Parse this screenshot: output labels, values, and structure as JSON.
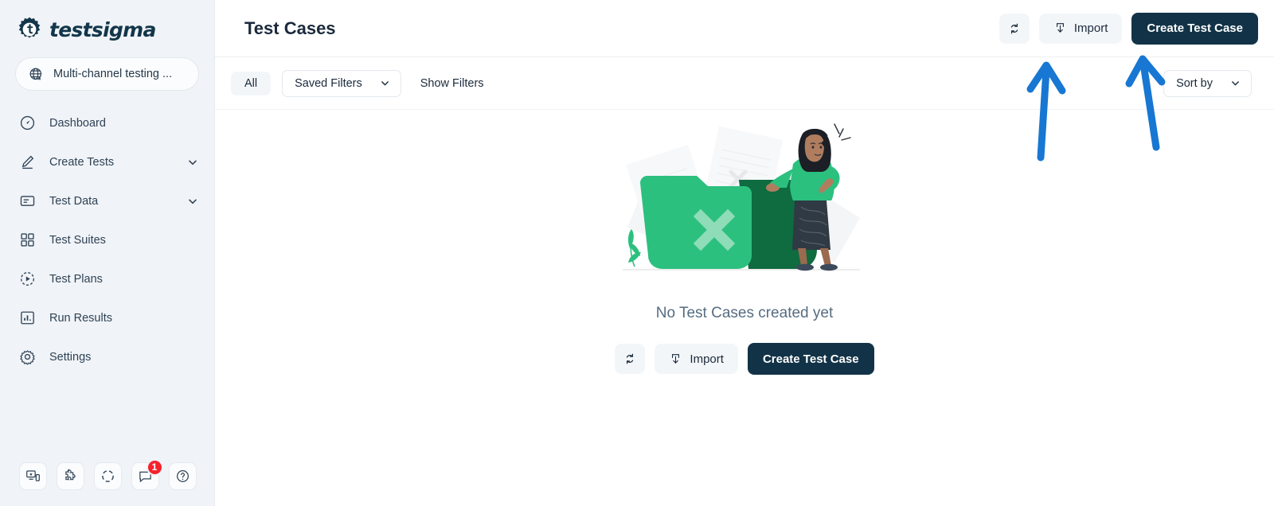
{
  "sidebar": {
    "brand": "testsigma",
    "brand_icon": "testsigma-gear-logo",
    "project": {
      "icon": "globe-icon",
      "name": "Multi-channel testing ..."
    },
    "nav": [
      {
        "label": "Dashboard",
        "icon": "speedometer-icon",
        "expandable": false
      },
      {
        "label": "Create Tests",
        "icon": "pencil-icon",
        "expandable": true
      },
      {
        "label": "Test Data",
        "icon": "data-folder-icon",
        "expandable": true
      },
      {
        "label": "Test Suites",
        "icon": "grid-squares-icon",
        "expandable": false
      },
      {
        "label": "Test Plans",
        "icon": "play-circle-icon",
        "expandable": false
      },
      {
        "label": "Run Results",
        "icon": "bar-chart-icon",
        "expandable": false
      },
      {
        "label": "Settings",
        "icon": "gear-icon",
        "expandable": false
      }
    ],
    "bottom_icons": [
      {
        "name": "devices-screen-icon",
        "badge": ""
      },
      {
        "name": "puzzle-piece-icon",
        "badge": ""
      },
      {
        "name": "dashed-circle-icon",
        "badge": ""
      },
      {
        "name": "notifications-icon",
        "badge": "1"
      },
      {
        "name": "help-question-icon",
        "badge": ""
      }
    ]
  },
  "header": {
    "title": "Test Cases",
    "refresh_icon": "refresh-icon",
    "import_icon": "import-download-icon",
    "import_label": "Import",
    "create_label": "Create Test Case"
  },
  "filters": {
    "all_label": "All",
    "saved_filters_label": "Saved Filters",
    "show_filters_label": "Show Filters",
    "sort_by_label": "Sort by",
    "chevron_icon": "chevron-down-icon"
  },
  "empty_state": {
    "illustration": "empty-folder-with-person-illustration",
    "title": "No Test Cases created yet",
    "refresh_icon": "refresh-icon",
    "import_icon": "import-download-icon",
    "import_label": "Import",
    "create_label": "Create Test Case"
  },
  "annotations": {
    "arrow_color": "#1877d2",
    "arrows": [
      {
        "name": "arrow-pointing-to-import-button"
      },
      {
        "name": "arrow-pointing-to-create-test-case-button"
      }
    ]
  },
  "colors": {
    "sidebar_bg": "#f0f3f7",
    "primary_dark": "#123347",
    "accent_green": "#2cc07f",
    "badge_red": "#f5222d",
    "annotation_blue": "#1877d2"
  }
}
